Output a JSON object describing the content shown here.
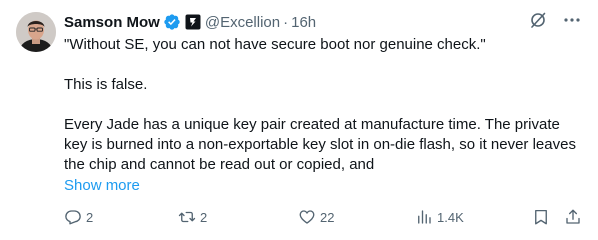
{
  "author": {
    "name": "Samson Mow",
    "handle": "@Excellion",
    "time": "16h",
    "separator": "·"
  },
  "post": {
    "paragraphs": [
      "\"Without SE, you can not have secure boot nor genuine check.\"",
      "This is false.",
      "Every Jade has a unique key pair created at manufacture time. The private key is burned into a non-exportable key slot in on-die flash, so it never leaves the chip and cannot be read out or copied, and"
    ],
    "show_more": "Show more"
  },
  "actions": {
    "replies": "2",
    "reposts": "2",
    "likes": "22",
    "views": "1.4K"
  },
  "colors": {
    "text": "#0f1419",
    "muted": "#536471",
    "link": "#1d9bf0",
    "verified": "#1d9bf0"
  },
  "icons": [
    "verified-badge-icon",
    "affiliate-badge-icon",
    "grok-icon",
    "more-icon",
    "reply-icon",
    "repost-icon",
    "like-icon",
    "views-icon",
    "bookmark-icon",
    "share-icon"
  ]
}
